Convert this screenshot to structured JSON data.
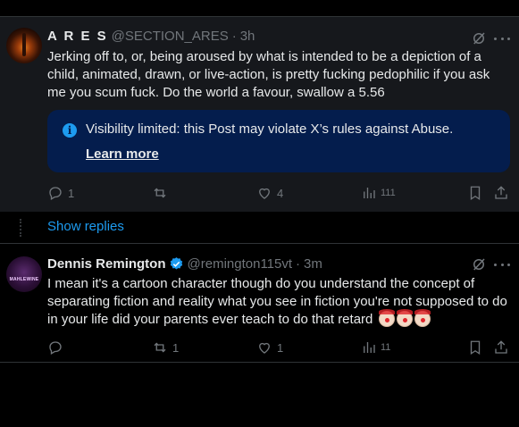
{
  "posts": [
    {
      "name": "A R E S",
      "handle": "@SECTION_ARES",
      "time": "3h",
      "text": "Jerking off to, or, being aroused by what is intended to be a depiction of a child, animated, drawn, or live-action, is pretty fucking pedophilic if you ask me you scum fuck. Do the world a favour, swallow a 5.56",
      "notice": {
        "text": "Visibility limited: this Post may violate X’s rules against Abuse.",
        "link": "Learn more"
      },
      "replies": "1",
      "reposts": "",
      "likes": "4",
      "views": "111"
    },
    {
      "name": "Dennis Remington",
      "handle": "@remington115vt",
      "time": "3m",
      "avatar_text": "MAHLEWINE",
      "text": "I mean it's a cartoon character though do you understand the concept of separating fiction and reality what you see in fiction you're not supposed to do in your life did your parents ever teach to do that retard",
      "emojis": [
        "clown-face",
        "clown-face",
        "clown-face"
      ],
      "replies": "",
      "reposts": "1",
      "likes": "1",
      "views": "11"
    }
  ],
  "show_replies": "Show replies",
  "colors": {
    "accent": "#1d9bf0",
    "muted": "#71767b",
    "notice_bg": "#041d4d",
    "post_bg": "#16181c"
  }
}
